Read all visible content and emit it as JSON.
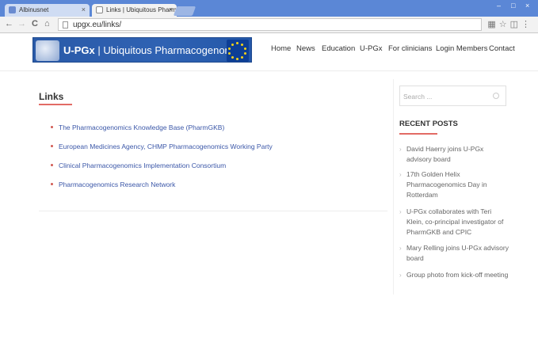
{
  "browser": {
    "tabs": [
      {
        "label": "Albinusnet",
        "close": "×"
      },
      {
        "label": "Links | Ubiquitous Pharma",
        "close": "×"
      }
    ],
    "url": "upgx.eu/links/",
    "window_controls": [
      "–",
      "□",
      "×"
    ]
  },
  "site": {
    "logo_text_bold": "U-PGx",
    "logo_text": "| Ubiquitous Pharmacogenomics",
    "nav": [
      "Home",
      "News",
      "Education",
      "U-PGx",
      "For clinicians",
      "Login Members",
      "Contact"
    ]
  },
  "main": {
    "title": "Links",
    "links": [
      "The Pharmacogenomics Knowledge Base (PharmGKB)",
      "European Medicines Agency, CHMP Pharmacogenomics Working Party",
      "Clinical Pharmacogenomics Implementation Consortium",
      "Pharmacogenomics Research Network"
    ]
  },
  "sidebar": {
    "search_placeholder": "Search ...",
    "recent_posts_title": "RECENT POSTS",
    "posts": [
      "David Haerry joins U-PGx advisory board",
      "17th Golden Helix Pharmacogenomics Day in Rotterdam",
      "U-PGx collaborates with Teri Klein, co-principal investigator of PharmGKB and CPIC",
      "Mary Relling joins U-PGx advisory board",
      "Group photo from kick-off meeting"
    ]
  },
  "colors": {
    "accent": "#e26b65",
    "link": "#3b57a8",
    "logo_blue": "#2f62b3"
  }
}
